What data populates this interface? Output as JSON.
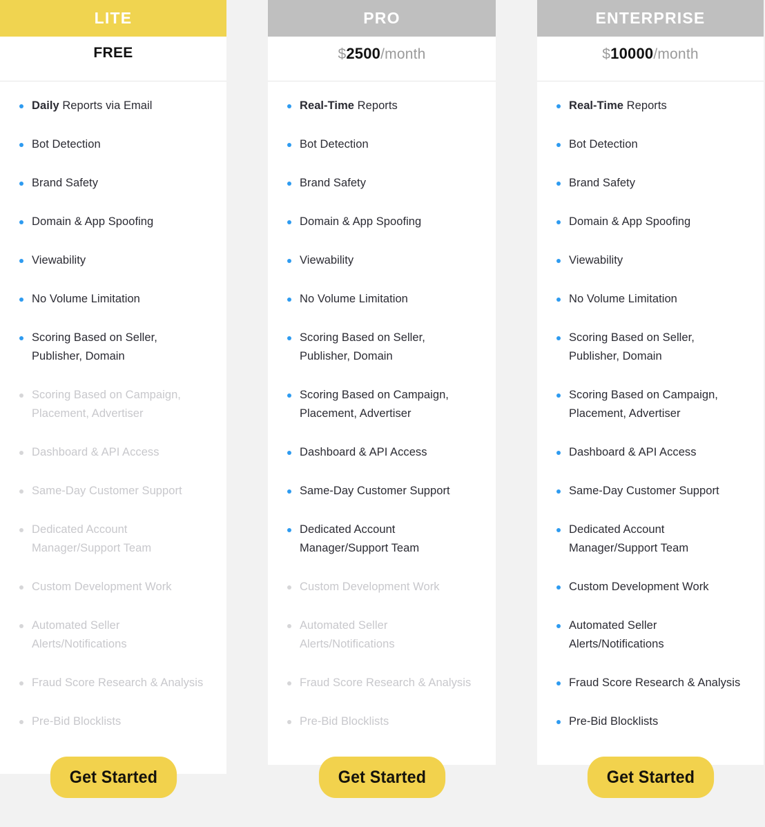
{
  "plans": [
    {
      "id": "lite",
      "name": "LITE",
      "header_color": "#f0d450",
      "price_type": "free",
      "price_free_label": "FREE",
      "currency": "",
      "amount": "",
      "period": "",
      "cta_label": "Get Started",
      "features": [
        {
          "bold_prefix": "Daily",
          "text": " Reports via Email",
          "enabled": true
        },
        {
          "bold_prefix": "",
          "text": "Bot Detection",
          "enabled": true
        },
        {
          "bold_prefix": "",
          "text": "Brand Safety",
          "enabled": true
        },
        {
          "bold_prefix": "",
          "text": "Domain & App Spoofing",
          "enabled": true
        },
        {
          "bold_prefix": "",
          "text": "Viewability",
          "enabled": true
        },
        {
          "bold_prefix": "",
          "text": "No Volume Limitation",
          "enabled": true
        },
        {
          "bold_prefix": "",
          "text": "Scoring Based on Seller, Publisher, Domain",
          "enabled": true
        },
        {
          "bold_prefix": "",
          "text": "Scoring Based on Campaign, Placement, Advertiser",
          "enabled": false
        },
        {
          "bold_prefix": "",
          "text": "Dashboard & API Access",
          "enabled": false
        },
        {
          "bold_prefix": "",
          "text": "Same-Day Customer Support",
          "enabled": false
        },
        {
          "bold_prefix": "",
          "text": "Dedicated Account Manager/Support Team",
          "enabled": false
        },
        {
          "bold_prefix": "",
          "text": "Custom Development Work",
          "enabled": false
        },
        {
          "bold_prefix": "",
          "text": "Automated Seller Alerts/Notifications",
          "enabled": false
        },
        {
          "bold_prefix": "",
          "text": "Fraud Score Research & Analysis",
          "enabled": false
        },
        {
          "bold_prefix": "",
          "text": "Pre-Bid Blocklists",
          "enabled": false
        }
      ]
    },
    {
      "id": "pro",
      "name": "PRO",
      "header_color": "#bfbfbf",
      "price_type": "paid",
      "price_free_label": "",
      "currency": "$",
      "amount": "2500",
      "period": "/month",
      "cta_label": "Get Started",
      "features": [
        {
          "bold_prefix": "Real-Time",
          "text": " Reports",
          "enabled": true
        },
        {
          "bold_prefix": "",
          "text": "Bot Detection",
          "enabled": true
        },
        {
          "bold_prefix": "",
          "text": "Brand Safety",
          "enabled": true
        },
        {
          "bold_prefix": "",
          "text": "Domain & App Spoofing",
          "enabled": true
        },
        {
          "bold_prefix": "",
          "text": "Viewability",
          "enabled": true
        },
        {
          "bold_prefix": "",
          "text": "No Volume Limitation",
          "enabled": true
        },
        {
          "bold_prefix": "",
          "text": "Scoring Based on Seller, Publisher, Domain",
          "enabled": true
        },
        {
          "bold_prefix": "",
          "text": "Scoring Based on Campaign, Placement, Advertiser",
          "enabled": true
        },
        {
          "bold_prefix": "",
          "text": "Dashboard & API Access",
          "enabled": true
        },
        {
          "bold_prefix": "",
          "text": "Same-Day Customer Support",
          "enabled": true
        },
        {
          "bold_prefix": "",
          "text": "Dedicated Account Manager/Support Team",
          "enabled": true
        },
        {
          "bold_prefix": "",
          "text": "Custom Development Work",
          "enabled": false
        },
        {
          "bold_prefix": "",
          "text": "Automated Seller Alerts/Notifications",
          "enabled": false
        },
        {
          "bold_prefix": "",
          "text": "Fraud Score Research & Analysis",
          "enabled": false
        },
        {
          "bold_prefix": "",
          "text": "Pre-Bid Blocklists",
          "enabled": false
        }
      ]
    },
    {
      "id": "enterprise",
      "name": "ENTERPRISE",
      "header_color": "#bfbfbf",
      "price_type": "paid",
      "price_free_label": "",
      "currency": "$",
      "amount": "10000",
      "period": "/month",
      "cta_label": "Get Started",
      "features": [
        {
          "bold_prefix": "Real-Time",
          "text": " Reports",
          "enabled": true
        },
        {
          "bold_prefix": "",
          "text": "Bot Detection",
          "enabled": true
        },
        {
          "bold_prefix": "",
          "text": "Brand Safety",
          "enabled": true
        },
        {
          "bold_prefix": "",
          "text": "Domain & App Spoofing",
          "enabled": true
        },
        {
          "bold_prefix": "",
          "text": "Viewability",
          "enabled": true
        },
        {
          "bold_prefix": "",
          "text": "No Volume Limitation",
          "enabled": true
        },
        {
          "bold_prefix": "",
          "text": "Scoring Based on Seller, Publisher, Domain",
          "enabled": true
        },
        {
          "bold_prefix": "",
          "text": "Scoring Based on Campaign, Placement, Advertiser",
          "enabled": true
        },
        {
          "bold_prefix": "",
          "text": "Dashboard & API Access",
          "enabled": true
        },
        {
          "bold_prefix": "",
          "text": "Same-Day Customer Support",
          "enabled": true
        },
        {
          "bold_prefix": "",
          "text": "Dedicated Account Manager/Support Team",
          "enabled": true
        },
        {
          "bold_prefix": "",
          "text": "Custom Development Work",
          "enabled": true
        },
        {
          "bold_prefix": "",
          "text": "Automated Seller Alerts/Notifications",
          "enabled": true
        },
        {
          "bold_prefix": "",
          "text": "Fraud Score Research & Analysis",
          "enabled": true
        },
        {
          "bold_prefix": "",
          "text": "Pre-Bid Blocklists",
          "enabled": true
        }
      ]
    }
  ],
  "colors": {
    "accent_yellow": "#f0d450",
    "header_gray": "#bfbfbf",
    "bullet_enabled": "#2e9bf0",
    "bullet_disabled": "#d6d6d8",
    "text_enabled": "#2b2b33",
    "text_disabled": "#c8c8cc",
    "page_background": "#f2f2f2",
    "cta_background": "#f2d24d"
  }
}
